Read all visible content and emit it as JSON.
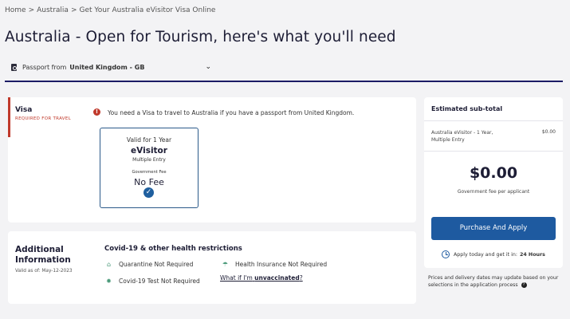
{
  "breadcrumb": [
    "Home",
    "Australia",
    "Get Your Australia eVisitor Visa Online"
  ],
  "breadcrumb_sep": ">",
  "page_title": "Australia - Open for Tourism, here's what you'll need",
  "passport": {
    "label": "Passport from",
    "country": "United Kingdom - GB"
  },
  "visa": {
    "label": "Visa",
    "required": "REQUIRED FOR TRAVEL",
    "alert": "You need a Visa to travel to Australia if you have a passport from United Kingdom.",
    "option": {
      "validity": "Valid for 1 Year",
      "name": "eVisitor",
      "entry": "Multiple Entry",
      "fee_label": "Government Fee",
      "fee": "No Fee"
    }
  },
  "info": {
    "title": "Additional Information",
    "valid_as_of": "Valid as of: May-12-2023",
    "covid_title": "Covid-19 & other health restrictions",
    "requirements": {
      "quarantine": "Quarantine Not Required",
      "insurance": "Health Insurance Not Required",
      "test": "Covid-19 Test Not Required"
    },
    "unvaccinated_prefix": "What if I'm",
    "unvaccinated_word": "unvaccinated",
    "unvaccinated_suffix": "?"
  },
  "summary": {
    "title": "Estimated sub-total",
    "item_name": "Australia eVisitor - 1 Year, Multiple Entry",
    "item_price": "$0.00",
    "total": "$0.00",
    "total_note": "Government fee per applicant",
    "purchase_label": "Purchase And Apply",
    "apply_note": "Apply today and get it in:",
    "apply_time": "24 Hours",
    "prices_note": "Prices and delivery dates may update based on your selections in the application process"
  },
  "colors": {
    "accent": "#1e5aa0",
    "alert": "#c0392b",
    "rule": "#1c1c66"
  }
}
